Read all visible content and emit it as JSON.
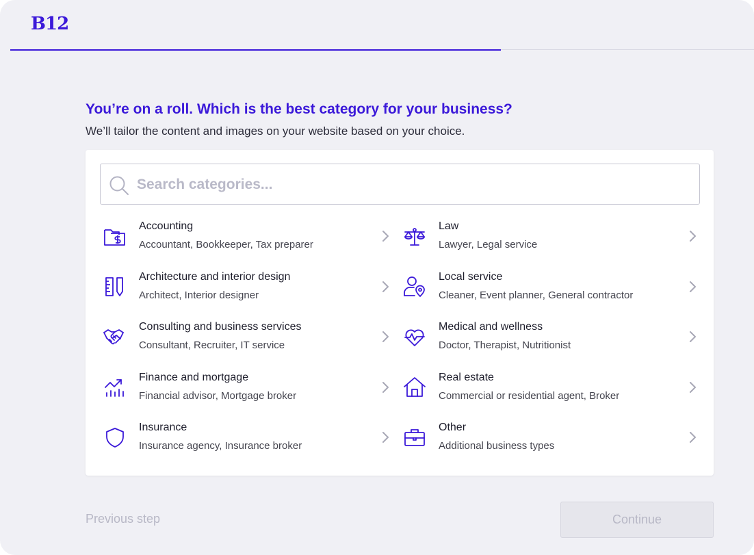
{
  "brand": {
    "logo_text": "B12",
    "accent": "#3b19d9"
  },
  "progress": {
    "fraction": 0.66
  },
  "heading": "You’re on a roll. Which is the best category for your business?",
  "subheading": "We’ll tailor the content and images on your website based on your choice.",
  "search": {
    "placeholder": "Search categories...",
    "value": "",
    "icon": "search-icon"
  },
  "categories": [
    {
      "title": "Accounting",
      "desc": "Accountant, Bookkeeper, Tax preparer",
      "icon": "folder-dollar-icon"
    },
    {
      "title": "Architecture and interior design",
      "desc": "Architect, Interior designer",
      "icon": "ruler-pencil-icon"
    },
    {
      "title": "Consulting and business services",
      "desc": "Consultant, Recruiter, IT service",
      "icon": "handshake-icon"
    },
    {
      "title": "Finance and mortgage",
      "desc": "Financial advisor, Mortgage broker",
      "icon": "chart-growth-icon"
    },
    {
      "title": "Insurance",
      "desc": "Insurance agency, Insurance broker",
      "icon": "shield-icon"
    },
    {
      "title": "Law",
      "desc": "Lawyer, Legal service",
      "icon": "scales-icon"
    },
    {
      "title": "Local service",
      "desc": "Cleaner, Event planner, General contractor",
      "icon": "person-location-icon"
    },
    {
      "title": "Medical and wellness",
      "desc": "Doctor, Therapist, Nutritionist",
      "icon": "heart-pulse-icon"
    },
    {
      "title": "Real estate",
      "desc": "Commercial or residential agent, Broker",
      "icon": "house-icon"
    },
    {
      "title": "Other",
      "desc": "Additional business types",
      "icon": "briefcase-icon"
    }
  ],
  "footer": {
    "previous_label": "Previous step",
    "continue_label": "Continue"
  }
}
